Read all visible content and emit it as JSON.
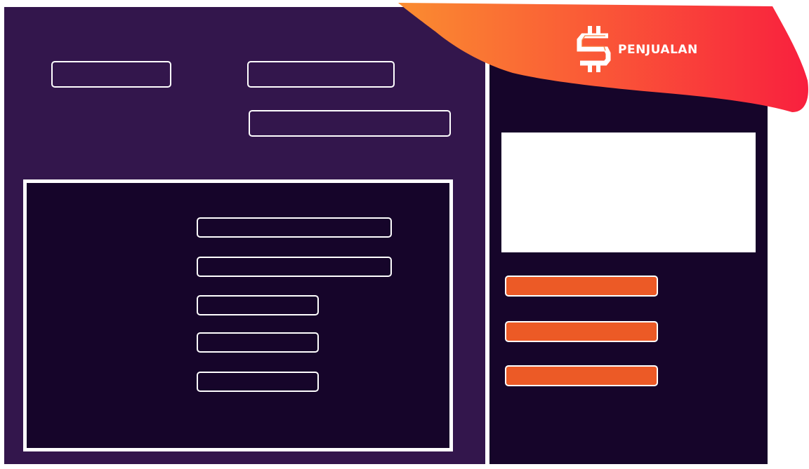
{
  "header": {
    "title": "PENJUALAN",
    "logo_icon": "dollar-sign-icon"
  },
  "colors": {
    "main_panel_bg": "#33164c",
    "side_panel_bg": "#16052a",
    "inner_panel_bg": "#16052a",
    "banner_gradient_start": "#fa8c30",
    "banner_gradient_end": "#f9203e",
    "action_button": "#ec5a26",
    "field_border": "#ffffff"
  },
  "form": {
    "top_fields": [
      "",
      "",
      ""
    ],
    "detail_fields": [
      "",
      "",
      "",
      "",
      ""
    ]
  },
  "preview": {
    "content": ""
  },
  "actions": {
    "buttons": [
      "",
      "",
      ""
    ]
  }
}
